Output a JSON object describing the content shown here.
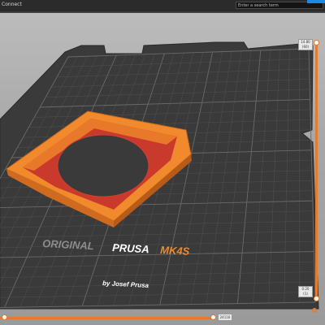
{
  "topbar": {
    "tab_label": "Connect",
    "search_placeholder": "Enter a search term"
  },
  "bed": {
    "brand_line": "ORIGINAL PRUSA MK4S",
    "brand_prefix": "ORIGINAL ",
    "brand_prusa": "PRUSA ",
    "brand_model": "MK4S",
    "brand_by": "by Josef Prusa"
  },
  "vertical_slider": {
    "top_value": "14.80",
    "top_sub": "(60)",
    "bottom_value": "0.20",
    "bottom_sub": "(1)",
    "icon": "cog-icon"
  },
  "horizontal_slider": {
    "value": "24116"
  },
  "colors": {
    "accent": "#e87a30",
    "bed": "#3b3b3b",
    "model_orange": "#f08a2c",
    "model_red": "#c0392b"
  }
}
